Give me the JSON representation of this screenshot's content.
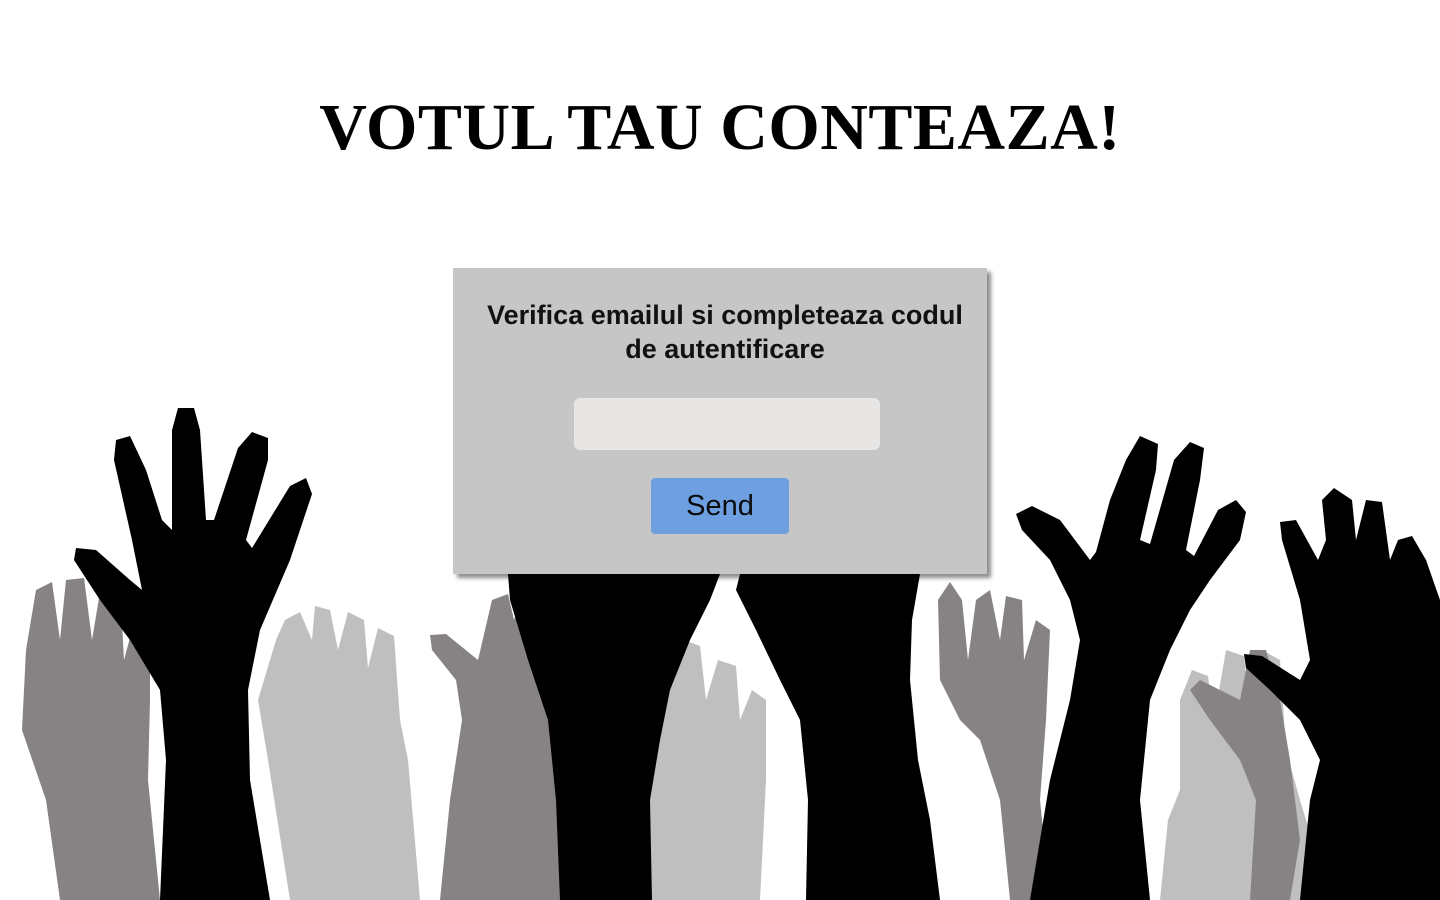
{
  "header": {
    "title": "VOTUL TAU CONTEAZA!"
  },
  "auth_form": {
    "instructions": "Verifica emailul si completeaza codul de autentificare",
    "code_input_value": "",
    "code_input_placeholder": "",
    "send_label": "Send"
  },
  "colors": {
    "background": "#ffffff",
    "card_background": "#c6c6c6",
    "input_background": "#e7e6e5",
    "send_button": "#6e9fe0",
    "hand_black": "#000000",
    "hand_dark_gray": "#878384",
    "hand_light_gray": "#bfbfbf"
  },
  "background_art": {
    "description_icon": "raised-hands-illustration"
  }
}
